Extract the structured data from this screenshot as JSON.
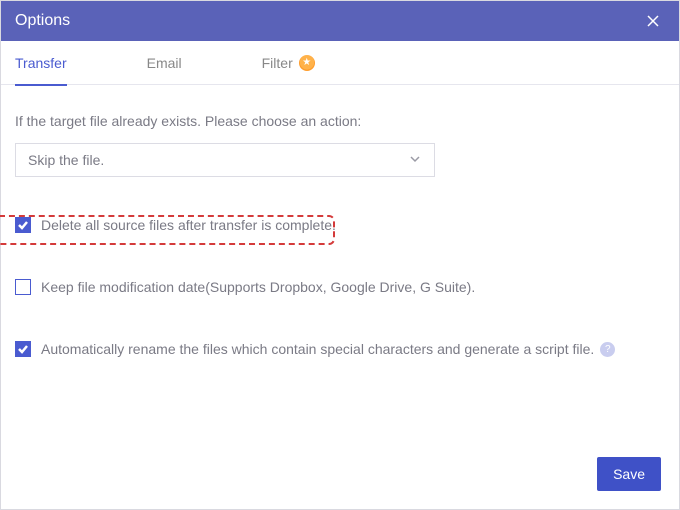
{
  "dialog": {
    "title": "Options"
  },
  "tabs": {
    "transfer": "Transfer",
    "email": "Email",
    "filter": "Filter"
  },
  "prompt": "If the target file already exists. Please choose an action:",
  "select": {
    "value": "Skip the file."
  },
  "options": {
    "delete_source": "Delete all source files after transfer is complete.",
    "keep_mod_date": "Keep file modification date(Supports Dropbox, Google Drive, G Suite).",
    "auto_rename": "Automatically rename the files which contain special characters and generate a script file."
  },
  "buttons": {
    "save": "Save"
  }
}
